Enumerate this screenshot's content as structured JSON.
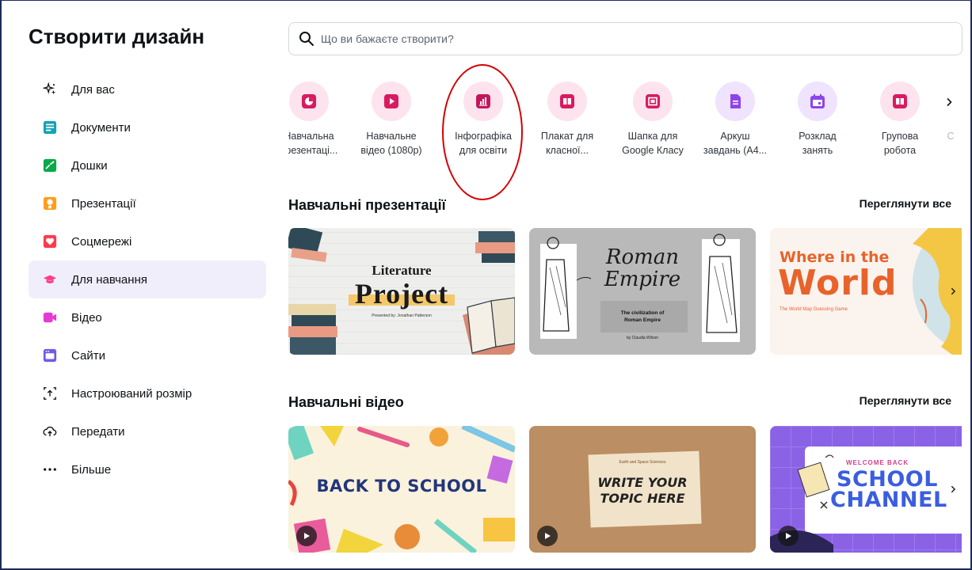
{
  "sidebar": {
    "title": "Створити дизайн",
    "items": [
      {
        "label": "Для вас",
        "icon": "sparkles-icon",
        "color": "#0d1216"
      },
      {
        "label": "Документи",
        "icon": "document-icon",
        "color": "#13a3b5"
      },
      {
        "label": "Дошки",
        "icon": "whiteboard-icon",
        "color": "#0ba84a"
      },
      {
        "label": "Презентації",
        "icon": "presentation-icon",
        "color": "#ff9e1b"
      },
      {
        "label": "Соцмережі",
        "icon": "heart-icon",
        "color": "#ff3b4b"
      },
      {
        "label": "Для навчання",
        "icon": "graduation-cap-icon",
        "color": "#ff3b8b",
        "active": true
      },
      {
        "label": "Відео",
        "icon": "video-icon",
        "color": "#e73ad4"
      },
      {
        "label": "Сайти",
        "icon": "website-icon",
        "color": "#6c5ce7"
      },
      {
        "label": "Настроюваний розмір",
        "icon": "custom-size-icon",
        "color": "#0d1216"
      },
      {
        "label": "Передати",
        "icon": "upload-cloud-icon",
        "color": "#0d1216"
      },
      {
        "label": "Більше",
        "icon": "more-dots-icon",
        "color": "#0d1216"
      }
    ]
  },
  "search": {
    "placeholder": "Що ви бажаєте створити?",
    "icon": "search-icon"
  },
  "categories": [
    {
      "line1": "Навчальна",
      "line2": "презентаці...",
      "icon": "pie-chart-icon",
      "bg": "#fde3ee",
      "fg": "#d81b60"
    },
    {
      "line1": "Навчальне",
      "line2": "відео (1080р)",
      "icon": "play-icon",
      "bg": "#fde3ee",
      "fg": "#d81b60"
    },
    {
      "line1": "Інфографіка",
      "line2": "для освіти",
      "icon": "bar-chart-icon",
      "bg": "#fde3ee",
      "fg": "#c2185b"
    },
    {
      "line1": "Плакат для",
      "line2": "класної...",
      "icon": "book-icon",
      "bg": "#fde3ee",
      "fg": "#d81b60"
    },
    {
      "line1": "Шапка для",
      "line2": "Google Класу",
      "icon": "screen-icon",
      "bg": "#fde3ee",
      "fg": "#d81b60"
    },
    {
      "line1": "Аркуш",
      "line2": "завдань (А4...",
      "icon": "worksheet-icon",
      "bg": "#efe3fd",
      "fg": "#8e44ec"
    },
    {
      "line1": "Розклад",
      "line2": "занять",
      "icon": "calendar-icon",
      "bg": "#efe3fd",
      "fg": "#8e44ec"
    },
    {
      "line1": "Групова",
      "line2": "робота",
      "icon": "book-icon",
      "bg": "#fde3ee",
      "fg": "#d81b60"
    },
    {
      "line1": "С",
      "line2": "",
      "icon": "next-item-icon",
      "bg": "#ffffff",
      "fg": "#ffffff"
    }
  ],
  "sections": [
    {
      "title": "Навчальні презентації",
      "see_all": "Переглянути все",
      "cards": [
        {
          "t1": "Literature",
          "t2": "Project",
          "t3": "Presented by: Jonathan Patterson"
        },
        {
          "t1": "Roman",
          "t2": "Empire",
          "t3a": "The civilization of",
          "t3b": "Roman Empire",
          "t4": "by Claudia Wilson"
        },
        {
          "t1": "Where in the",
          "t2": "World",
          "t3": "The World Map Guessing Game"
        }
      ]
    },
    {
      "title": "Навчальні відео",
      "see_all": "Переглянути все",
      "cards": [
        {
          "t1": "BACK TO SCHOOL"
        },
        {
          "t0": "Earth and Space Sciences",
          "t1a": "WRITE YOUR",
          "t1b": "TOPIC HERE"
        },
        {
          "t0": "WELCOME BACK",
          "t1": "SCHOOL",
          "t2": "CHANNEL"
        }
      ]
    }
  ],
  "colors": {
    "annotation": "#d40000",
    "active_bg": "#f1eefc",
    "accent": "#7d2ae8"
  }
}
